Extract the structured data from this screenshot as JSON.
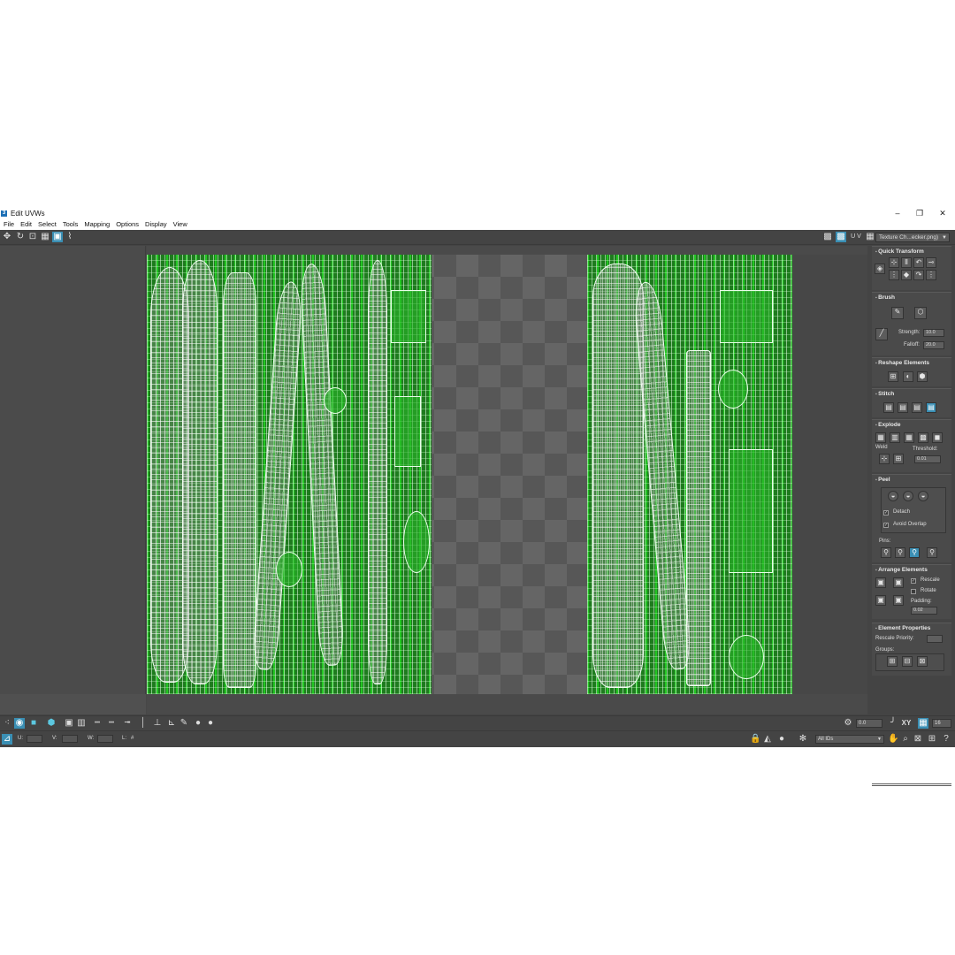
{
  "window": {
    "title": "Edit UVWs",
    "app_icon": "3",
    "controls": [
      "–",
      "❐",
      "✕"
    ]
  },
  "menu": [
    "File",
    "Edit",
    "Select",
    "Tools",
    "Mapping",
    "Options",
    "Display",
    "View"
  ],
  "toolbar": {
    "uv_label": "U V",
    "texture_dropdown": "Texture Ch...ecker.png)"
  },
  "panel": {
    "quick_transform": {
      "title": "Quick Transform"
    },
    "brush": {
      "title": "Brush",
      "strength_label": "Strength:",
      "strength_value": "10.0",
      "falloff_label": "Falloff:",
      "falloff_value": "20.0"
    },
    "reshape": {
      "title": "Reshape Elements"
    },
    "stitch": {
      "title": "Stitch"
    },
    "explode": {
      "title": "Explode",
      "weld_label": "Weld",
      "threshold_label": "Threshold:",
      "threshold_value": "0.01"
    },
    "peel": {
      "title": "Peel",
      "detach_label": "Detach",
      "avoid_overlap_label": "Avoid Overlap",
      "pins_label": "Pins:"
    },
    "arrange": {
      "title": "Arrange Elements",
      "rescale_label": "Rescale",
      "rotate_label": "Rotate",
      "padding_label": "Padding:",
      "padding_value": "0.02"
    },
    "element_properties": {
      "title": "Element Properties",
      "rescale_priority_label": "Rescale Priority:",
      "groups_label": "Groups:"
    }
  },
  "bottom_toolbar": {
    "angle_value": "0.0",
    "xy_label": "XY",
    "grid_value": "16"
  },
  "status": {
    "u_label": "U:",
    "v_label": "V:",
    "w_label": "W:",
    "l_label": "L:",
    "l_value": "#",
    "ids_dropdown": "All IDs"
  },
  "colors": {
    "uv_wire": "#23c623",
    "selection_accent": "#3a8fb4",
    "background": "#444444"
  }
}
